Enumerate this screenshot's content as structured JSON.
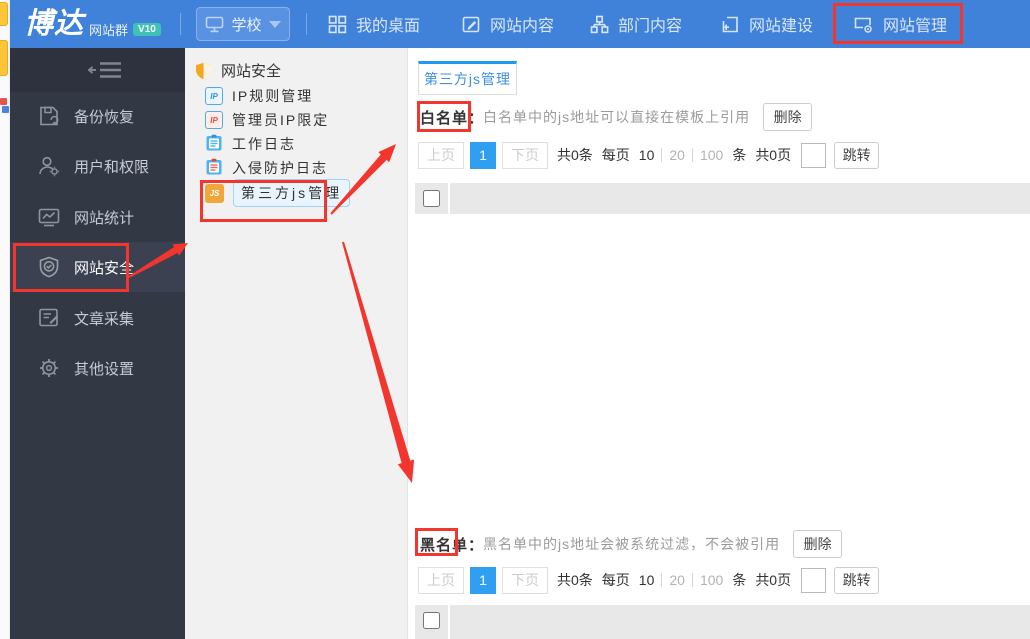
{
  "app": {
    "brand_large": "博达",
    "brand_small": "网站群",
    "version_badge": "V10"
  },
  "topnav": {
    "site_selector": {
      "label": "学校",
      "icon": "monitor-icon"
    },
    "items": [
      {
        "label": "我的桌面",
        "icon": "desktop-grid-icon"
      },
      {
        "label": "网站内容",
        "icon": "edit-pen-icon"
      },
      {
        "label": "部门内容",
        "icon": "org-sitemap-icon"
      },
      {
        "label": "网站建设",
        "icon": "site-build-plus-icon"
      },
      {
        "label": "网站管理",
        "icon": "site-manage-gear-icon",
        "highlighted": true
      }
    ]
  },
  "sidebar": {
    "collapse_icon": "collapse-menu-icon",
    "items": [
      {
        "label": "备份恢复",
        "icon": "backup-restore-icon"
      },
      {
        "label": "用户和权限",
        "icon": "user-permission-icon"
      },
      {
        "label": "网站统计",
        "icon": "site-stats-icon"
      },
      {
        "label": "网站安全",
        "icon": "security-shield-icon",
        "active": true
      },
      {
        "label": "文章采集",
        "icon": "article-collect-icon"
      },
      {
        "label": "其他设置",
        "icon": "settings-gear-icon"
      }
    ]
  },
  "submenu": {
    "header": {
      "label": "网站安全",
      "icon": "shield-orange-icon"
    },
    "items": [
      {
        "label": "IP规则管理",
        "icon": "ip-blue-icon"
      },
      {
        "label": "管理员IP限定",
        "icon": "ip-red-icon"
      },
      {
        "label": "工作日志",
        "icon": "log-blue-icon"
      },
      {
        "label": "入侵防护日志",
        "icon": "log-red-icon"
      },
      {
        "label": "第三方js管理",
        "icon": "js-orange-icon",
        "selected": true
      }
    ]
  },
  "content": {
    "tab": "第三方js管理",
    "whitelist": {
      "label": "白名单",
      "colon": "：",
      "description": "白名单中的js地址可以直接在模板上引用",
      "delete_button": "删除",
      "pagination": {
        "prev": "上页",
        "current": "1",
        "next": "下页",
        "total": "共0条",
        "per_page": "每页",
        "sizes": [
          "10",
          "20",
          "100"
        ],
        "unit": "条",
        "pages": "共0页",
        "jump_value": "",
        "jump_label": "跳转"
      }
    },
    "blacklist": {
      "label": "黑名单",
      "colon": "：",
      "description": "黑名单中的js地址会被系统过滤，不会被引用",
      "delete_button": "删除",
      "pagination": {
        "prev": "上页",
        "current": "1",
        "next": "下页",
        "total": "共0条",
        "per_page": "每页",
        "sizes": [
          "10",
          "20",
          "100"
        ],
        "unit": "条",
        "pages": "共0页",
        "jump_value": "",
        "jump_label": "跳转"
      }
    }
  },
  "annotations": {
    "color": "#f2362e",
    "boxes": [
      "site-manage-nav",
      "site-security-sidebar",
      "thirdparty-js-submenu",
      "whitelist-label",
      "blacklist-label"
    ],
    "arrows": [
      {
        "from": [
          129,
          277
        ],
        "to": [
          188,
          243
        ],
        "tail_width": 2,
        "shaft_width": 7,
        "head_width": 13,
        "head_length": 14
      },
      {
        "from": [
          331,
          214
        ],
        "to": [
          396,
          144
        ],
        "tail_width": 2,
        "shaft_width": 8,
        "head_width": 15,
        "head_length": 18
      },
      {
        "from": [
          343,
          242
        ],
        "to": [
          412,
          483
        ],
        "tail_width": 2,
        "shaft_width": 9,
        "head_width": 17,
        "head_length": 22
      }
    ]
  },
  "colors": {
    "topnav": "#4081d9",
    "sidebar": "#333845",
    "sidebar_active": "#3b4150",
    "submenu_bg": "#f1f1f2",
    "tab_accent": "#1e9af0",
    "page_active": "#2f9ff2",
    "badge": "#3fc2b6",
    "annotation": "#f2362e",
    "row_gray": "#e8e8e8"
  }
}
